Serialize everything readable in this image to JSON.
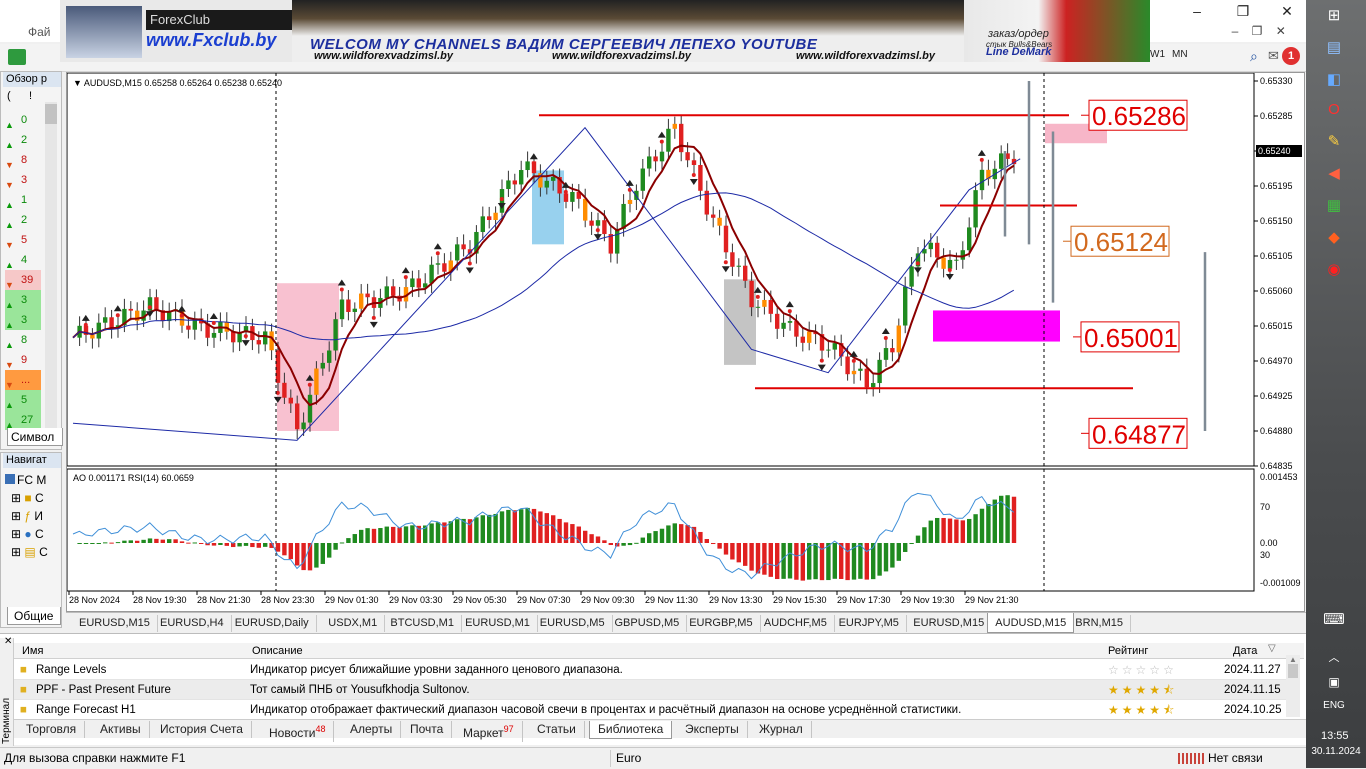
{
  "window": {
    "menu_fragment": "Фай",
    "buttons": {
      "minimize": "–",
      "restore": "❐",
      "close": "✕"
    }
  },
  "toolbar": {
    "timeframes": [
      "W1",
      "MN"
    ]
  },
  "notification_count": "1",
  "banner": {
    "logo": "ForexClub",
    "site": "www.Fxclub.by",
    "title": "WELCOM MY CHANNELS ВАДИМ СЕРГЕЕВИЧ ЛЕПЕХО YOUTUBE",
    "sites": [
      "www.wildforexvadzimsl.by",
      "www.wildforexvadzimsl.by",
      "www.wildforexvadzimsl.by"
    ],
    "order": "заказ/ордер",
    "stick": "стык Bulls&Bears",
    "demark": "Line DeMark"
  },
  "market_watch": {
    "title": "Обзор р",
    "header_a": "(",
    "header_b": "!",
    "rows": [
      {
        "dir": "up",
        "val": "0"
      },
      {
        "dir": "up",
        "val": "2"
      },
      {
        "dir": "dn",
        "val": "8"
      },
      {
        "dir": "dn",
        "val": "3"
      },
      {
        "dir": "up",
        "val": "1"
      },
      {
        "dir": "up",
        "val": "2"
      },
      {
        "dir": "dn",
        "val": "5"
      },
      {
        "dir": "up",
        "val": "4"
      },
      {
        "dir": "dn",
        "val": "39"
      },
      {
        "dir": "up",
        "val": "3"
      },
      {
        "dir": "up",
        "val": "3"
      },
      {
        "dir": "up",
        "val": "8"
      },
      {
        "dir": "dn",
        "val": "9"
      },
      {
        "dir": "dn",
        "val": "..."
      },
      {
        "dir": "up",
        "val": "5"
      },
      {
        "dir": "up",
        "val": "27"
      }
    ],
    "symbols_tab": "Символ"
  },
  "navigator": {
    "title": "Навигат",
    "root": "FC M",
    "items": [
      "С",
      "И",
      "С",
      "С"
    ],
    "tab": "Общие"
  },
  "chart": {
    "info": "AUDUSD,M15  0.65258 0.65264 0.65238 0.65240",
    "current_price": "0.65240",
    "price_ticks": [
      "0.65330",
      "0.65285",
      "0.65240",
      "0.65195",
      "0.65150",
      "0.65105",
      "0.65060",
      "0.65015",
      "0.64970",
      "0.64925",
      "0.64880",
      "0.64835"
    ],
    "time_ticks": [
      "28 Nov 2024",
      "28 Nov 19:30",
      "28 Nov 21:30",
      "28 Nov 23:30",
      "29 Nov 01:30",
      "29 Nov 03:30",
      "29 Nov 05:30",
      "29 Nov 07:30",
      "29 Nov 09:30",
      "29 Nov 11:30",
      "29 Nov 13:30",
      "29 Nov 15:30",
      "29 Nov 17:30",
      "29 Nov 19:30",
      "29 Nov 21:30"
    ],
    "levels": [
      "0.65286",
      "0.65124",
      "0.65001",
      "0.64877"
    ],
    "sub_info": "AO 0.001171  RSI(14) 60.0659",
    "sub_ticks": [
      "0.001453",
      "70",
      "0.00",
      "30",
      "-0.001009"
    ],
    "colors": {
      "bull": "#1f8a1f",
      "bear": "#e02020",
      "orange": "#ff8c00",
      "level": "#e00000",
      "magenta": "#ff00ff",
      "pink": "#f7b6c8",
      "ma": "#8b0000",
      "ma_slow": "#1d2aa6"
    }
  },
  "chart_tabs": [
    "EURUSD,M15",
    "EURUSD,H4",
    "EURUSD,Daily",
    "USDX,M1",
    "BTCUSD,M1",
    "EURUSD,M1",
    "EURUSD,M5",
    "GBPUSD,M5",
    "EURGBP,M5",
    "AUDCHF,M5",
    "EURJPY,M5",
    "EURUSD,M15",
    "AUDUSD,M15",
    "BRN,M15"
  ],
  "active_chart_tab": 12,
  "terminal": {
    "side_label": "Терминал",
    "columns": {
      "name": "Имя",
      "desc": "Описание",
      "rating": "Рейтинг",
      "date": "Дата"
    },
    "rows": [
      {
        "name": "Range Levels",
        "desc": "Индикатор рисует ближайшие уровни заданного ценового диапазона.",
        "rating": 0,
        "date": "2024.11.27"
      },
      {
        "name": "PPF - Past Present Future",
        "desc": "Тот самый ПНБ от Yousufkhodja Sultonov.",
        "rating": 4.5,
        "date": "2024.11.15"
      },
      {
        "name": "Range Forecast H1",
        "desc": "Индикатор отображает фактический диапазон часовой свечи в процентах и расчётный диапазон на основе усреднённой статистики.",
        "rating": 4.5,
        "date": "2024.10.25"
      }
    ],
    "tabs": [
      {
        "label": "Торговля"
      },
      {
        "label": "Активы"
      },
      {
        "label": "История Счета"
      },
      {
        "label": "Новости",
        "badge": "48"
      },
      {
        "label": "Алерты"
      },
      {
        "label": "Почта"
      },
      {
        "label": "Маркет",
        "badge": "97"
      },
      {
        "label": "Статьи"
      },
      {
        "label": "Библиотека"
      },
      {
        "label": "Эксперты"
      },
      {
        "label": "Журнал"
      }
    ],
    "active_tab": 8
  },
  "status": {
    "help": "Для вызова справки нажмите F1",
    "profile": "Euro",
    "connection": "Нет связи"
  },
  "taskbar": {
    "lang": "ENG",
    "time": "13:55",
    "date": "30.11.2024"
  }
}
